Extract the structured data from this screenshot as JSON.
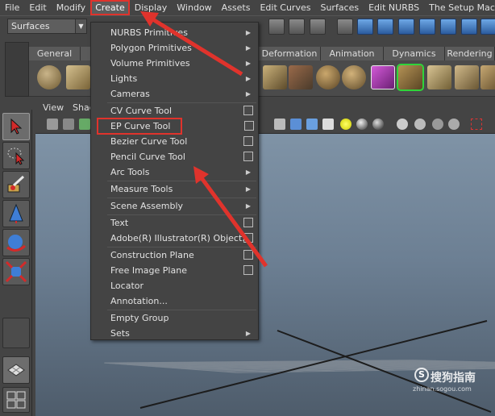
{
  "menubar": {
    "items": [
      "File",
      "Edit",
      "Modify",
      "Create",
      "Display",
      "Window",
      "Assets",
      "Edit Curves",
      "Surfaces",
      "Edit NURBS",
      "The Setup Machine"
    ]
  },
  "status_line": {
    "mode": "Surfaces"
  },
  "shelf": {
    "tabs": [
      "General",
      "Deformation",
      "Animation",
      "Dynamics",
      "Rendering"
    ]
  },
  "panel": {
    "menus": [
      "View",
      "Shad"
    ]
  },
  "create_menu": {
    "groups": [
      [
        {
          "label": "NURBS Primitives",
          "submenu": true
        },
        {
          "label": "Polygon Primitives",
          "submenu": true
        },
        {
          "label": "Volume Primitives",
          "submenu": true
        },
        {
          "label": "Lights",
          "submenu": true
        },
        {
          "label": "Cameras",
          "submenu": true
        }
      ],
      [
        {
          "label": "CV Curve Tool",
          "option": true
        },
        {
          "label": "EP Curve Tool",
          "option": true
        },
        {
          "label": "Bezier Curve Tool",
          "option": true
        },
        {
          "label": "Pencil Curve Tool",
          "option": true
        },
        {
          "label": "Arc Tools",
          "submenu": true
        }
      ],
      [
        {
          "label": "Measure Tools",
          "submenu": true
        }
      ],
      [
        {
          "label": "Scene Assembly",
          "submenu": true
        }
      ],
      [
        {
          "label": "Text",
          "option": true
        },
        {
          "label": "Adobe(R) Illustrator(R) Object...",
          "option": true
        }
      ],
      [
        {
          "label": "Construction Plane",
          "option": true
        },
        {
          "label": "Free Image Plane",
          "option": true
        },
        {
          "label": "Locator"
        },
        {
          "label": "Annotation..."
        }
      ],
      [
        {
          "label": "Empty Group"
        },
        {
          "label": "Sets",
          "submenu": true
        }
      ]
    ]
  },
  "watermark": {
    "main": "搜狗指南",
    "sub": "zhinan.sogou.com"
  },
  "colors": {
    "annotation_red": "#e0332c",
    "menu_bg": "#444444",
    "viewport_top": "#7f93a6"
  }
}
